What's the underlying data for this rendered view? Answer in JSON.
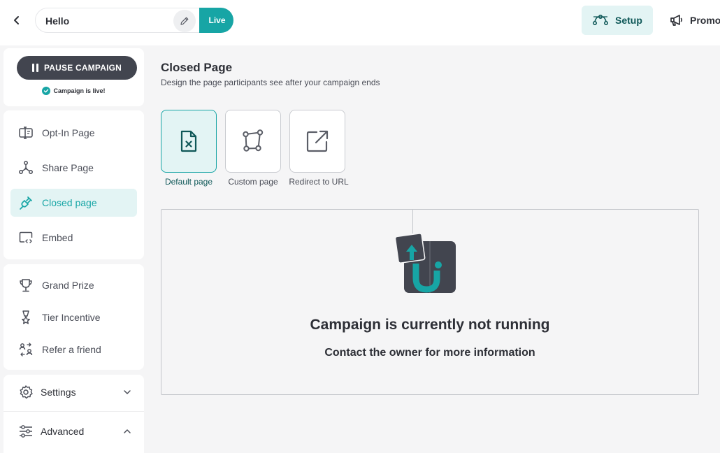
{
  "header": {
    "campaign_name": "Hello",
    "live_label": "Live",
    "setup_tab": "Setup",
    "promote_tab": "Promo"
  },
  "sidebar": {
    "pause_button": "PAUSE CAMPAIGN",
    "live_status": "Campaign is live!",
    "pages": [
      {
        "label": "Opt-In Page",
        "icon": "opt-in-icon"
      },
      {
        "label": "Share Page",
        "icon": "share-icon"
      },
      {
        "label": "Closed page",
        "icon": "plug-icon",
        "active": true
      },
      {
        "label": "Embed",
        "icon": "embed-icon"
      }
    ],
    "prizes": [
      {
        "label": "Grand Prize",
        "icon": "trophy-icon"
      },
      {
        "label": "Tier Incentive",
        "icon": "medal-icon"
      },
      {
        "label": "Refer a friend",
        "icon": "refer-icon"
      }
    ],
    "settings": {
      "label": "Settings",
      "icon": "gear-icon"
    },
    "advanced": {
      "label": "Advanced",
      "icon": "sliders-icon"
    }
  },
  "main": {
    "title": "Closed Page",
    "subtitle": "Design the page participants see after your campaign ends",
    "options": [
      {
        "label": "Default page",
        "icon": "file-x-icon",
        "selected": true
      },
      {
        "label": "Custom page",
        "icon": "shape-icon"
      },
      {
        "label": "Redirect to URL",
        "icon": "external-link-icon"
      }
    ],
    "preview": {
      "title": "Campaign is currently not running",
      "subtitle": "Contact the owner for more information"
    }
  },
  "colors": {
    "accent": "#17a5a5",
    "accent_light": "#e3f4f4",
    "dark": "#42454f"
  }
}
